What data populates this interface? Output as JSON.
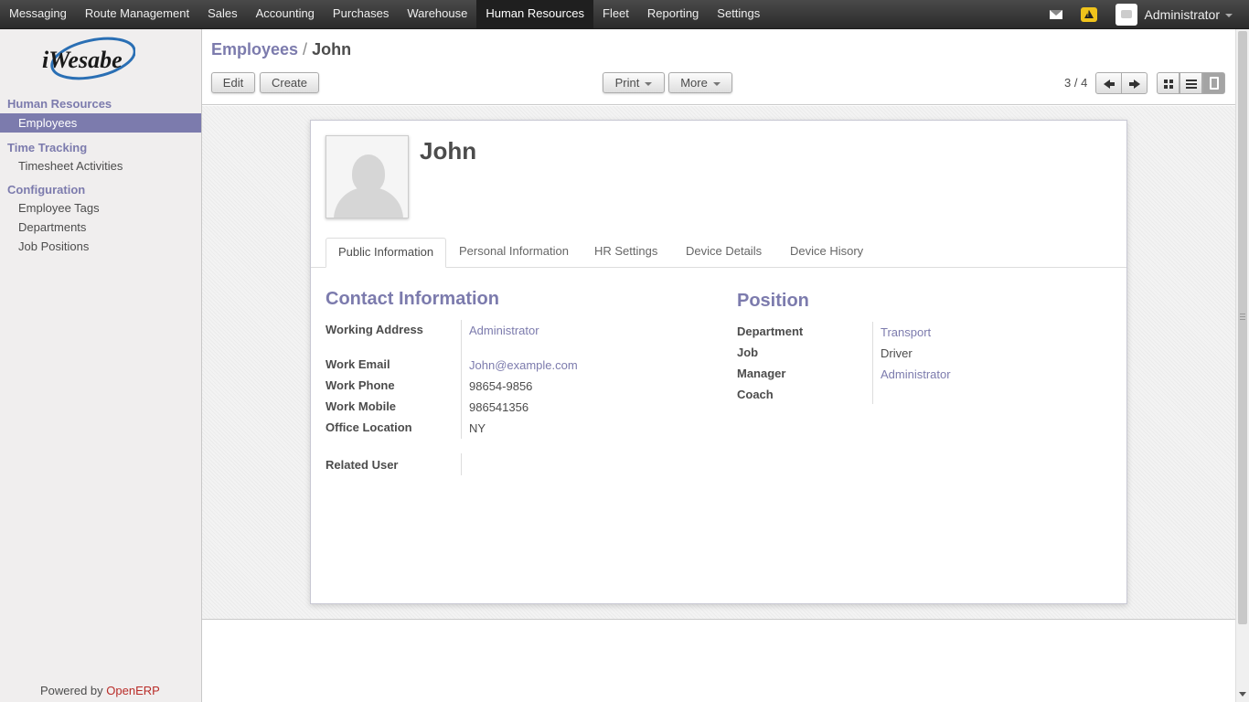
{
  "topmenu": {
    "items": [
      "Messaging",
      "Route Management",
      "Sales",
      "Accounting",
      "Purchases",
      "Warehouse",
      "Human Resources",
      "Fleet",
      "Reporting",
      "Settings"
    ],
    "active": "Human Resources",
    "user": "Administrator"
  },
  "sidebar": {
    "logo_text": "iWesabe",
    "sections": [
      {
        "title": "Human Resources",
        "items": [
          "Employees"
        ]
      },
      {
        "title": "Time Tracking",
        "items": [
          "Timesheet Activities"
        ]
      },
      {
        "title": "Configuration",
        "items": [
          "Employee Tags",
          "Departments",
          "Job Positions"
        ]
      }
    ],
    "active_item": "Employees",
    "powered_by": "Powered by",
    "powered_brand": "OpenERP"
  },
  "header": {
    "breadcrumb_root": "Employees",
    "breadcrumb_sep": "/",
    "breadcrumb_current": "John",
    "edit_label": "Edit",
    "create_label": "Create",
    "print_label": "Print",
    "more_label": "More",
    "pager": "3 / 4"
  },
  "employee": {
    "name": "John",
    "tabs": [
      "Public Information",
      "Personal Information",
      "HR Settings",
      "Device Details",
      "Device Hisory"
    ],
    "active_tab": "Public Information",
    "contact": {
      "title": "Contact Information",
      "working_address_label": "Working Address",
      "working_address": "Administrator",
      "work_email_label": "Work Email",
      "work_email": "John@example.com",
      "work_phone_label": "Work Phone",
      "work_phone": "98654-9856",
      "work_mobile_label": "Work Mobile",
      "work_mobile": "986541356",
      "office_location_label": "Office Location",
      "office_location": "NY",
      "related_user_label": "Related User",
      "related_user": ""
    },
    "position": {
      "title": "Position",
      "department_label": "Department",
      "department": "Transport",
      "job_label": "Job",
      "job": "Driver",
      "manager_label": "Manager",
      "manager": "Administrator",
      "coach_label": "Coach",
      "coach": ""
    }
  },
  "colors": {
    "accent": "#7c7bad",
    "brand_red": "#b92c28",
    "topbar": "#2b2b2b"
  }
}
